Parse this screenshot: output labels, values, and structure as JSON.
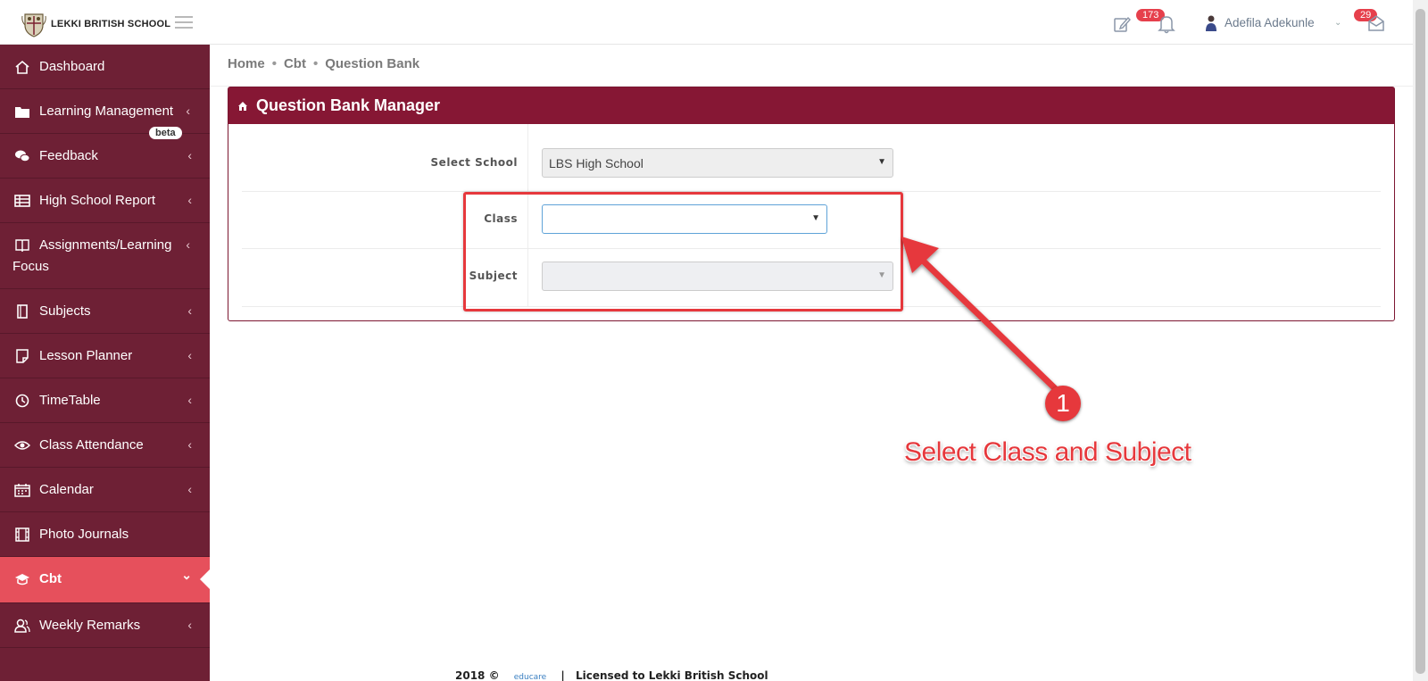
{
  "brand": {
    "name": "LEKKI BRITISH SCHOOL"
  },
  "header": {
    "notifications_count": "173",
    "messages_count": "29",
    "user_name": "Adefila Adekunle",
    "icons": [
      "edit-icon",
      "bell-icon",
      "user-icon",
      "mail-icon",
      "hamburger-icon"
    ]
  },
  "sidebar": {
    "items": [
      {
        "label": "Dashboard",
        "icon": "home-icon",
        "caret": ""
      },
      {
        "label": "Learning Management",
        "icon": "folder-icon",
        "caret": "‹"
      },
      {
        "label": "Feedback",
        "icon": "comments-icon",
        "caret": "‹",
        "badge": "beta"
      },
      {
        "label": "High School Report",
        "icon": "table-icon",
        "caret": "‹"
      },
      {
        "label": "Assignments/Learning Focus",
        "icon": "book-icon",
        "caret": "‹"
      },
      {
        "label": "Subjects",
        "icon": "notebook-icon",
        "caret": "‹"
      },
      {
        "label": "Lesson Planner",
        "icon": "sticky-note-icon",
        "caret": "‹"
      },
      {
        "label": "TimeTable",
        "icon": "clock-icon",
        "caret": "‹"
      },
      {
        "label": "Class Attendance",
        "icon": "eye-icon",
        "caret": "‹"
      },
      {
        "label": "Calendar",
        "icon": "calendar-icon",
        "caret": "‹"
      },
      {
        "label": "Photo Journals",
        "icon": "film-icon",
        "caret": ""
      },
      {
        "label": "Cbt",
        "icon": "graduation-cap-icon",
        "caret": "⌄",
        "active": true
      },
      {
        "label": "Weekly Remarks",
        "icon": "users-icon",
        "caret": "‹"
      }
    ]
  },
  "breadcrumb": [
    "Home",
    "Cbt",
    "Question Bank"
  ],
  "breadcrumb_separator": "•",
  "panel": {
    "title": "Question Bank Manager",
    "fields": {
      "school": {
        "label": "Select School",
        "value": "LBS High School"
      },
      "class": {
        "label": "Class",
        "value": ""
      },
      "subject": {
        "label": "Subject",
        "value": ""
      }
    }
  },
  "annotation": {
    "number": "1",
    "text": "Select Class and Subject",
    "color": "#e6383c"
  },
  "footer": {
    "year": "2018 ©",
    "logo_text": "educare",
    "separator": "|",
    "license": "Licensed to Lekki British School"
  },
  "colors": {
    "sidebar_bg": "#6e2035",
    "active_item": "#e6505c",
    "panel_header": "#861734",
    "badge": "#e6404c"
  }
}
